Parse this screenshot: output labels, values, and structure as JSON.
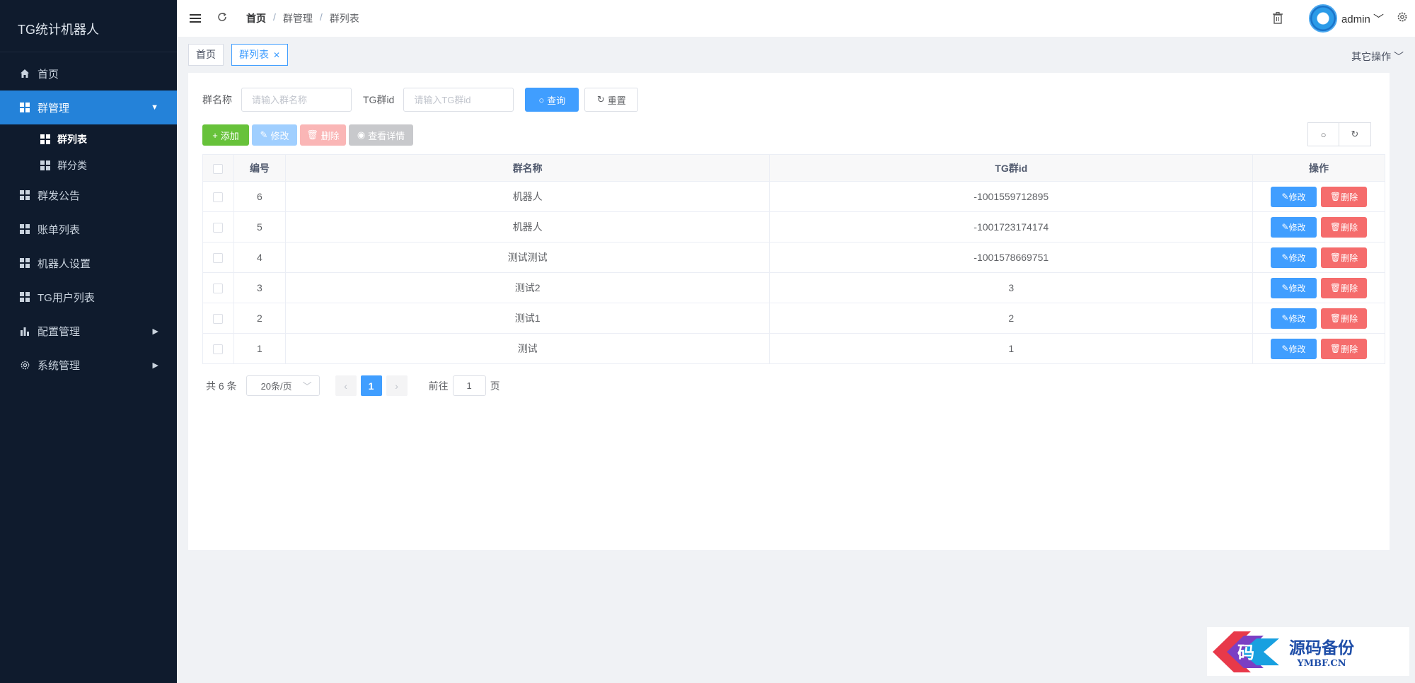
{
  "sidebar": {
    "brand": "TG统计机器人",
    "items": [
      {
        "label": "首页",
        "icon": "home-icon"
      },
      {
        "label": "群管理",
        "icon": "grid-icon",
        "active": true,
        "arrow": "▼"
      },
      {
        "label": "群发公告",
        "icon": "grid-icon"
      },
      {
        "label": "账单列表",
        "icon": "grid-icon"
      },
      {
        "label": "机器人设置",
        "icon": "grid-icon"
      },
      {
        "label": "TG用户列表",
        "icon": "grid-icon"
      },
      {
        "label": "配置管理",
        "icon": "bar-chart-icon",
        "arrow": "▶"
      },
      {
        "label": "系统管理",
        "icon": "gear-icon",
        "arrow": "▶"
      }
    ],
    "subitems": [
      {
        "label": "群列表",
        "current": true
      },
      {
        "label": "群分类"
      }
    ]
  },
  "header": {
    "breadcrumb": [
      "首页",
      "群管理",
      "群列表"
    ],
    "user": "admin"
  },
  "tabs": {
    "items": [
      "首页",
      "群列表"
    ],
    "other_ops": "其它操作"
  },
  "search": {
    "name_label": "群名称",
    "name_placeholder": "请输入群名称",
    "id_label": "TG群id",
    "id_placeholder": "请输入TG群id",
    "query": "查询",
    "reset": "重置"
  },
  "toolbar": {
    "add": "添加",
    "edit": "修改",
    "delete": "删除",
    "view": "查看详情"
  },
  "table": {
    "columns": [
      "编号",
      "群名称",
      "TG群id",
      "操作"
    ],
    "rows": [
      {
        "id": "6",
        "name": "机器人",
        "tgid": "-1001559712895"
      },
      {
        "id": "5",
        "name": "机器人",
        "tgid": "-1001723174174"
      },
      {
        "id": "4",
        "name": "测试测试",
        "tgid": "-1001578669751"
      },
      {
        "id": "3",
        "name": "测试2",
        "tgid": "3"
      },
      {
        "id": "2",
        "name": "测试1",
        "tgid": "2"
      },
      {
        "id": "1",
        "name": "测试",
        "tgid": "1"
      }
    ],
    "row_edit": "修改",
    "row_delete": "删除"
  },
  "pagination": {
    "total": "共 6 条",
    "page_size": "20条/页",
    "current": "1",
    "goto_label": "前往",
    "goto_value": "1",
    "page_suffix": "页"
  },
  "watermark": {
    "logo_char": "码",
    "cn": "源码备份",
    "en": "YMBF.CN"
  },
  "colors": {
    "sidebar_bg": "#0f1b2d",
    "active": "#2482d9",
    "primary": "#409eff",
    "success": "#67c23a",
    "danger": "#f56c6c"
  }
}
